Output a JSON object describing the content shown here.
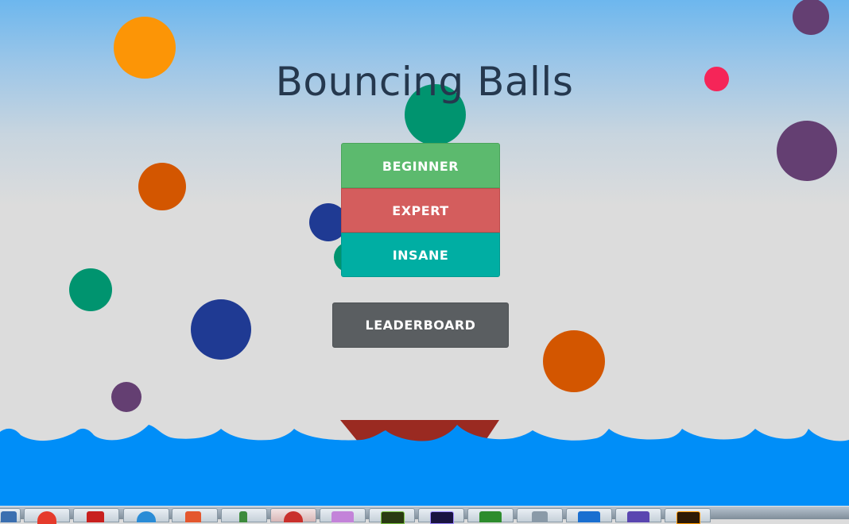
{
  "game": {
    "title": "Bouncing Balls"
  },
  "menu": {
    "beginner_label": "BEGINNER",
    "expert_label": "EXPERT",
    "insane_label": "INSANE",
    "leaderboard_label": "LEADERBOARD"
  },
  "colors": {
    "sky_top": "#6db7ee",
    "background": "#dcdcdc",
    "water": "#008ef8",
    "paddle": "#9a2a21",
    "beginner": "#5cba6e",
    "expert": "#d45d5d",
    "insane": "#00aea3",
    "leaderboard": "#5a5e61",
    "title": "#25384e"
  },
  "ball_colors": [
    "orange",
    "dark-orange",
    "green",
    "navy",
    "purple",
    "crimson"
  ],
  "taskbar": {
    "icons": [
      "start-orb-icon",
      "chrome-icon",
      "filezilla-icon",
      "firefox-icon",
      "git-icon",
      "notepad-icon",
      "tool-icon",
      "itunes-icon",
      "dreamweaver-icon",
      "after-effects-icon",
      "greenfoot-icon",
      "clipboard-icon",
      "photoshop-icon",
      "premiere-icon",
      "illustrator-icon"
    ]
  }
}
